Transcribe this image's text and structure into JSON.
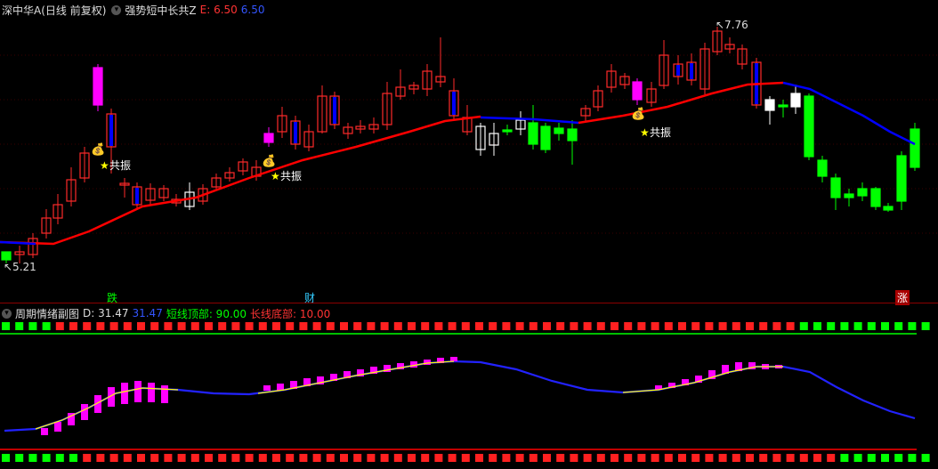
{
  "main": {
    "stock_name": "深中华A(日线 前复权)",
    "indicator_name": "强势短中长共Z",
    "e_label": "E: 6.50",
    "e_value2": "6.50",
    "high_marker": "7.76",
    "low_marker": "5.21",
    "resonance_label": "共振",
    "event_badges": [
      {
        "text": "跌",
        "color": "#00ff00",
        "bg": "#1a2a1a"
      },
      {
        "text": "财",
        "color": "#00ffff",
        "bg": "#112233"
      },
      {
        "text": "涨",
        "color": "#ffffff",
        "bg": "#aa0000"
      }
    ],
    "colors": {
      "up": "#ff2a2a",
      "down": "#00ff00",
      "ma": "#ff0000",
      "ma_flat": "#0000ff",
      "signal": "#ff00ff",
      "neutral": "#ffffff"
    }
  },
  "sub": {
    "title": "周期情绪副图",
    "d_value": "D: 31.47",
    "d_value2": "31.47",
    "short_top": "短线顶部: 90.00",
    "long_bottom": "长线底部: 10.00",
    "top_line_color": "#00ff00",
    "bottom_line_color": "#ff0000"
  }
}
